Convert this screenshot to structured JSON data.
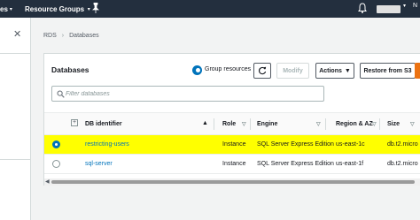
{
  "topnav": {
    "services_partial": "es",
    "resource_groups": "Resource Groups",
    "account_initial": "N"
  },
  "breadcrumb": {
    "items": [
      "RDS",
      "Databases"
    ]
  },
  "panel": {
    "title": "Databases",
    "group_resources_label": "Group resources",
    "modify_label": "Modify",
    "actions_label": "Actions",
    "restore_label": "Restore from S3",
    "filter_placeholder": "Filter databases"
  },
  "table": {
    "columns": [
      "DB identifier",
      "Role",
      "Engine",
      "Region & AZ",
      "Size"
    ],
    "rows": [
      {
        "selected": true,
        "identifier": "restricting-users",
        "role": "Instance",
        "engine": "SQL Server Express Edition",
        "region": "us-east-1c",
        "size": "db.t2.micro"
      },
      {
        "selected": false,
        "identifier": "sql-server",
        "role": "Instance",
        "engine": "SQL Server Express Edition",
        "region": "us-east-1f",
        "size": "db.t2.micro"
      }
    ]
  },
  "colors": {
    "nav_bg": "#232f3e",
    "highlight": "#ffff00",
    "link": "#0073bb",
    "accent": "#ec7211"
  },
  "icons": [
    "caret-down-icon",
    "pin-icon",
    "bell-icon",
    "close-icon",
    "refresh-icon",
    "search-icon",
    "sort-asc-icon",
    "filter-icon",
    "radio-icon",
    "expand-icon"
  ]
}
